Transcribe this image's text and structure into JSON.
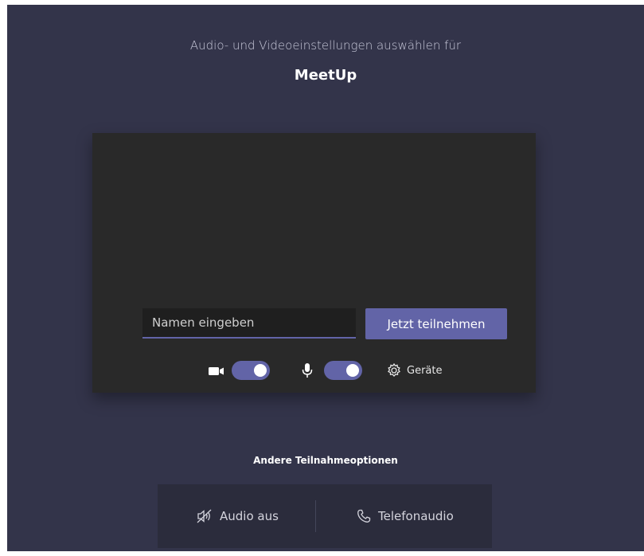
{
  "header": {
    "subtitle": "Audio- und Videoeinstellungen auswählen für",
    "meeting_title": "MeetUp"
  },
  "join": {
    "name_placeholder": "Namen eingeben",
    "name_value": "",
    "join_label": "Jetzt teilnehmen"
  },
  "controls": {
    "camera_icon": "camera-icon",
    "camera_on": true,
    "mic_icon": "microphone-icon",
    "mic_on": true,
    "devices_icon": "gear-icon",
    "devices_label": "Geräte"
  },
  "other_options": {
    "title": "Andere Teilnahmeoptionen",
    "audio_off_icon": "speaker-muted-icon",
    "audio_off_label": "Audio aus",
    "phone_icon": "phone-icon",
    "phone_label": "Telefonaudio"
  },
  "colors": {
    "background": "#33344a",
    "preview": "#292929",
    "accent": "#6264a7"
  }
}
